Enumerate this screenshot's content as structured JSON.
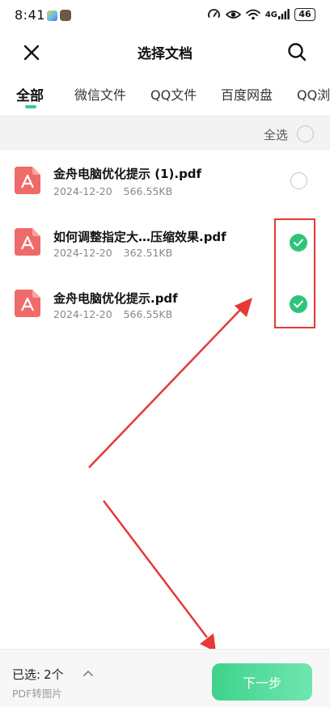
{
  "status_bar": {
    "time": "8:41",
    "signal_label": "4G",
    "battery": "46"
  },
  "header": {
    "title": "选择文档",
    "close_icon": "close-icon",
    "search_icon": "search-icon"
  },
  "tabs": [
    {
      "label": "全部",
      "active": true
    },
    {
      "label": "微信文件",
      "active": false
    },
    {
      "label": "QQ文件",
      "active": false
    },
    {
      "label": "百度网盘",
      "active": false
    },
    {
      "label": "QQ浏",
      "active": false
    }
  ],
  "select_all": {
    "label": "全选",
    "checked": false
  },
  "files": [
    {
      "name": "金舟电脑优化提示 (1).pdf",
      "date": "2024-12-20",
      "size": "566.55KB",
      "selected": false,
      "icon": "pdf-icon"
    },
    {
      "name": "如何调整指定大…压缩效果.pdf",
      "date": "2024-12-20",
      "size": "362.51KB",
      "selected": true,
      "icon": "pdf-icon"
    },
    {
      "name": "金舟电脑优化提示.pdf",
      "date": "2024-12-20",
      "size": "566.55KB",
      "selected": true,
      "icon": "pdf-icon"
    }
  ],
  "bottom_bar": {
    "selected_label": "已选:",
    "selected_count": "2个",
    "subtitle": "PDF转图片",
    "next_label": "下一步"
  },
  "colors": {
    "accent_green": "#2fc47a",
    "annotation_red": "#e53935",
    "pdf_red": "#f06a6a"
  }
}
